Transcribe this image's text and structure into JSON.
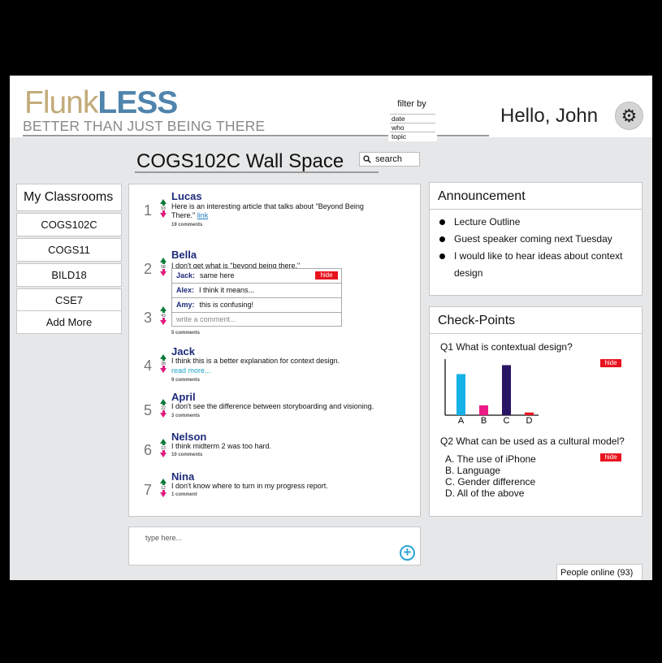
{
  "brand": {
    "name_part1": "Flunk",
    "name_part2": "LESS",
    "tagline": "BETTER THAN JUST BEING THERE"
  },
  "filter": {
    "title": "filter by",
    "options": [
      "date",
      "who",
      "topic"
    ]
  },
  "header": {
    "greeting": "Hello, John",
    "settings_icon": "gear-icon"
  },
  "page": {
    "title": "COGS102C Wall Space"
  },
  "search": {
    "label": "search",
    "icon": "search-icon"
  },
  "classrooms": {
    "title": "My Classrooms",
    "items": [
      {
        "label": "COGS102C"
      },
      {
        "label": "COGS11"
      },
      {
        "label": "BILD18"
      },
      {
        "label": "CSE7"
      },
      {
        "label": "Add More"
      }
    ]
  },
  "posts": [
    {
      "rank": "1",
      "votes": "93",
      "name": "Lucas",
      "text": "Here is an interesting article that talks about \"Beyond Being There.\"",
      "link": "link",
      "comments": "19 comments"
    },
    {
      "rank": "2",
      "votes": "58",
      "name": "Bella",
      "text": "I don't get what is \"beyond being there.\""
    },
    {
      "rank": "3",
      "votes": "43",
      "comments": "5 comments"
    },
    {
      "rank": "4",
      "votes": "38",
      "name": "Jack",
      "text": "I think this is a better explanation for context design.",
      "link": "read more...",
      "comments": "9 comments"
    },
    {
      "rank": "5",
      "votes": "22",
      "name": "April",
      "text": "I don't see the difference between storyboarding and visioning.",
      "comments": "3 comments"
    },
    {
      "rank": "6",
      "votes": "13",
      "name": "Nelson",
      "text": "I think midterm 2 was too hard.",
      "comments": "10 comments"
    },
    {
      "rank": "7",
      "votes": "12",
      "name": "Nina",
      "text": "I don't know where to turn in my progress report.",
      "comments": "1 comment"
    }
  ],
  "thread": {
    "hide_label": "hide",
    "comments": [
      {
        "author": "Jack:",
        "text": "same here"
      },
      {
        "author": "Alex:",
        "text": "I think it means..."
      },
      {
        "author": "Amy:",
        "text": "this is confusing!"
      }
    ],
    "input_placeholder": "write a comment..."
  },
  "composer": {
    "placeholder": "type here...",
    "add_icon": "add-circle-icon"
  },
  "announcement": {
    "title": "Announcement",
    "items": [
      "Lecture Outline",
      "Guest speaker coming next Tuesday",
      "I would like to hear ideas about context design"
    ]
  },
  "checkpoints": {
    "title": "Check-Points",
    "hide_label": "hide",
    "q1": "Q1 What is contextual design?",
    "q2": "Q2 What can be used as a cultural model?",
    "q2_answers": [
      "A. The use of iPhone",
      "B. Language",
      "C. Gender difference",
      "D. All of the above"
    ]
  },
  "chart_data": {
    "type": "bar",
    "categories": [
      "A",
      "B",
      "C",
      "D"
    ],
    "values": [
      46,
      11,
      56,
      3
    ],
    "colors": [
      "#16b1e6",
      "#ec1b85",
      "#2a1464",
      "#e8121e"
    ],
    "ylim": [
      0,
      60
    ]
  },
  "footer": {
    "online": "People online (93)"
  }
}
